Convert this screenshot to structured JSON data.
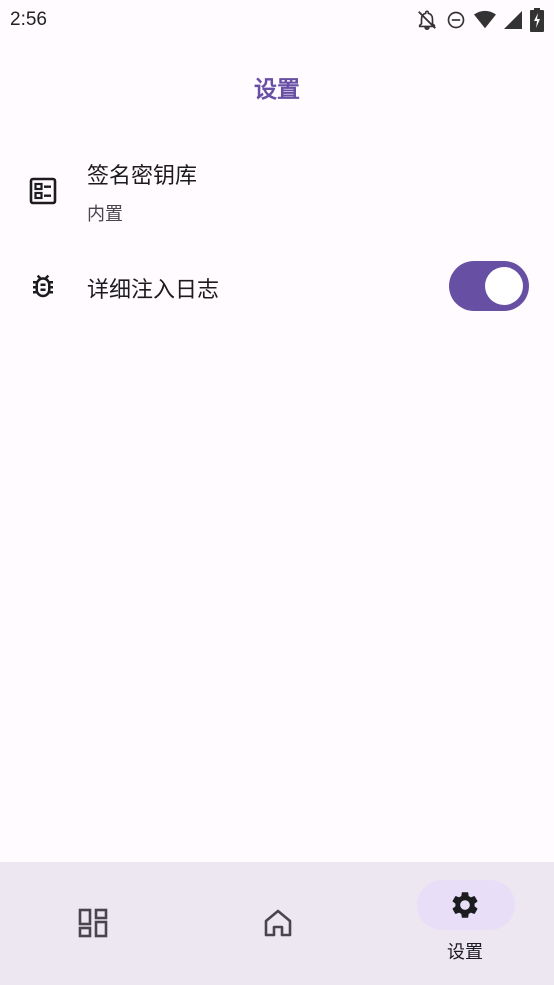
{
  "status_bar": {
    "time": "2:56",
    "icons": [
      "notifications-off-icon",
      "do-not-disturb-icon",
      "wifi-icon",
      "signal-icon",
      "battery-charging-icon"
    ]
  },
  "header": {
    "title": "设置"
  },
  "settings": {
    "keystore": {
      "title": "签名密钥库",
      "subtitle": "内置",
      "icon": "keystore-icon"
    },
    "verbose_log": {
      "title": "详细注入日志",
      "icon": "bug-icon",
      "enabled": true
    }
  },
  "bottom_nav": {
    "items": [
      {
        "id": "modules",
        "icon": "dashboard-icon",
        "label": ""
      },
      {
        "id": "home",
        "icon": "home-icon",
        "label": ""
      },
      {
        "id": "settings",
        "icon": "settings-icon",
        "label": "设置",
        "selected": true
      }
    ]
  },
  "colors": {
    "primary": "#6750A4",
    "background": "#FFFBFE",
    "nav_background": "#EDE7F2",
    "nav_indicator": "#E8DEF8"
  }
}
